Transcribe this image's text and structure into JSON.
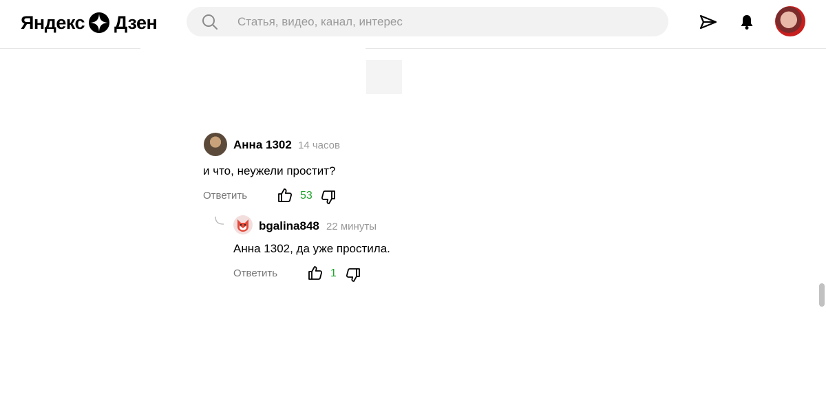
{
  "header": {
    "logo_left": "Яндекс",
    "logo_right": "Дзен",
    "search_placeholder": "Статья, видео, канал, интерес",
    "search_value": ""
  },
  "icons": {
    "logo": "dzen-star-icon",
    "search": "search-icon",
    "send": "paper-plane-icon",
    "notifications": "bell-icon",
    "thumb_up": "thumb-up-icon",
    "thumb_down": "thumb-down-icon"
  },
  "comments": [
    {
      "author": "Анна 1302",
      "time": "14 часов",
      "text": "и что, неужели простит?",
      "reply_label": "Ответить",
      "likes": "53"
    },
    {
      "author": "bgalina848",
      "time": "22 минуты",
      "text": "Анна 1302, да уже простила.",
      "reply_label": "Ответить",
      "likes": "1"
    }
  ],
  "colors": {
    "likes": "#1fa32b",
    "muted": "#999999",
    "search_bg": "#f2f2f2"
  }
}
